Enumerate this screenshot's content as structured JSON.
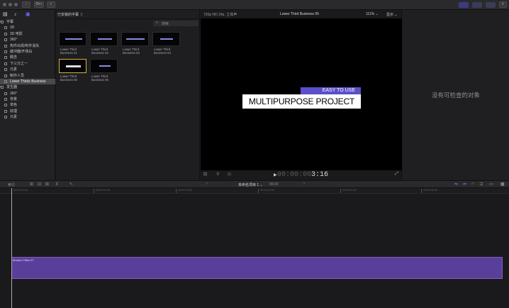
{
  "toolbar": {
    "key_btn_label": "O⊷",
    "check_btn_label": "✓"
  },
  "sidebar": {
    "items": [
      {
        "label": "字幕",
        "type": "group"
      },
      {
        "label": "3D",
        "type": "child"
      },
      {
        "label": "3D 电影",
        "type": "child"
      },
      {
        "label": "360°",
        "type": "child"
      },
      {
        "label": "构件出现/构件消失",
        "type": "child"
      },
      {
        "label": "缓冲器/开场白",
        "type": "child"
      },
      {
        "label": "概念",
        "type": "child"
      },
      {
        "label": "下三分之一",
        "type": "child"
      },
      {
        "label": "元素",
        "type": "child"
      },
      {
        "label": "制作人员",
        "type": "child"
      },
      {
        "label": "Lower Thirds Business",
        "type": "child",
        "selected": true
      },
      {
        "label": "发生器",
        "type": "group"
      },
      {
        "label": "360°",
        "type": "child"
      },
      {
        "label": "背景",
        "type": "child"
      },
      {
        "label": "单色",
        "type": "child"
      },
      {
        "label": "纹理",
        "type": "child"
      },
      {
        "label": "元素",
        "type": "child"
      }
    ]
  },
  "browser": {
    "title": "已安装的字幕 ⇧",
    "search_placeholder": "搜索",
    "thumbs": [
      {
        "caption1": "Lower Third",
        "caption2": "Business 01"
      },
      {
        "caption1": "Lower Third",
        "caption2": "Business 02"
      },
      {
        "caption1": "Lower Third",
        "caption2": "Business 03"
      },
      {
        "caption1": "Lower Third",
        "caption2": "Business 04"
      },
      {
        "caption1": "Lower Third",
        "caption2": "Business 05",
        "selected": true
      },
      {
        "caption1": "Lower Third",
        "caption2": "Business 06"
      }
    ]
  },
  "viewer": {
    "format": "720p HD 24p, 立体声",
    "title": "Lower Third Business 05",
    "zoom": "111% ⌄",
    "show": "显示 ⌄",
    "lower_third_top": "EASY TO USE",
    "lower_third_main": "MULTIPURPOSE PROJECT",
    "timecode_dim": "00:00:00",
    "timecode_live": "3:16"
  },
  "inspector": {
    "empty_message": "没有可检查的对象"
  },
  "timeline": {
    "index_label": "索引",
    "project_name": "未命名项目 1 ⌄",
    "duration": "06:00",
    "ruler_ticks": [
      "00:00:00:00",
      "00:00:01:00",
      "00:00:02:00",
      "00:00:03:00",
      "00:00:04:00",
      "00:00:05:00"
    ],
    "clip_label": "Modern Titles 07"
  },
  "colors": {
    "accent_purple": "#5b50c8",
    "clip_purple": "#5a3f9a",
    "selection_gold": "#d7b23a"
  }
}
